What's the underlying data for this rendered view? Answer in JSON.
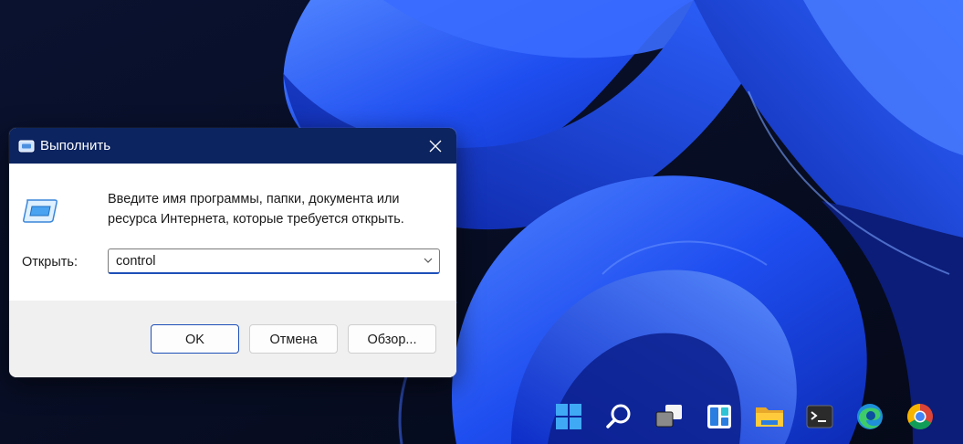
{
  "dialog": {
    "title": "Выполнить",
    "description": "Введите имя программы, папки, документа или ресурса Интернета, которые требуется открыть.",
    "open_label": "Открыть:",
    "input_value": "control",
    "buttons": {
      "ok": "OK",
      "cancel": "Отмена",
      "browse": "Обзор..."
    },
    "icons": [
      "run-icon",
      "close-icon",
      "chevron-down-icon"
    ]
  },
  "taskbar": {
    "items": [
      "start-icon",
      "search-icon",
      "task-view-icon",
      "widgets-icon",
      "file-explorer-icon",
      "terminal-icon",
      "edge-icon",
      "chrome-icon"
    ]
  },
  "colors": {
    "titlebar": "#0c2460",
    "accent": "#1d4fb8",
    "footer": "#f0f0f0",
    "wallpaper_blue": "#1f4ef0",
    "wallpaper_dark": "#070d22"
  }
}
